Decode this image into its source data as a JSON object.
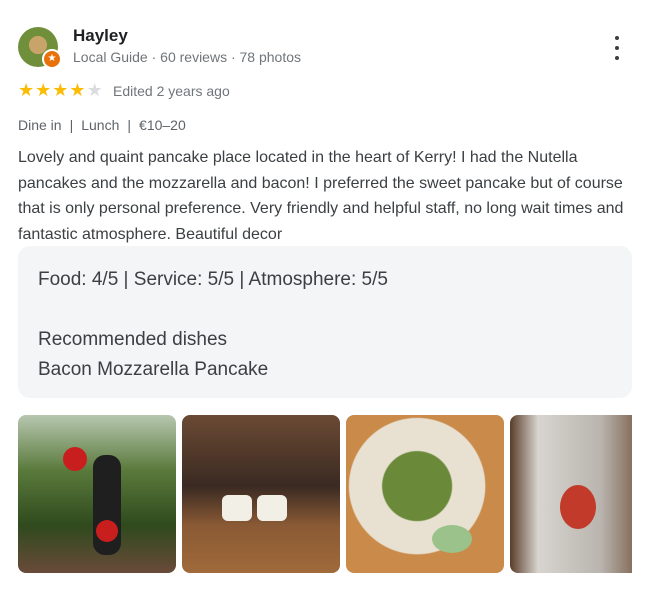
{
  "reviewer": {
    "name": "Hayley",
    "meta": "Local Guide · 60 reviews · 78 photos",
    "badge_icon": "local-guide-star"
  },
  "rating": {
    "stars": 4,
    "max": 5,
    "edited": "Edited 2 years ago"
  },
  "tags": {
    "dine": "Dine in",
    "sep1": "|",
    "meal": "Lunch",
    "sep2": "|",
    "price": "€10–20"
  },
  "review_text": "Lovely and quaint pancake place located in the heart of Kerry! I had the Nutella pancakes and the mozzarella and bacon! I preferred the sweet pancake but of course that is only personal preference. Very friendly and helpful staff, no long wait times and fantastic atmosphere. Beautiful decor",
  "ratings_card": {
    "scores": "Food: 4/5  |  Service: 5/5  |  Atmosphere: 5/5",
    "recommended_heading": "Recommended dishes",
    "recommended_dish": "Bacon Mozzarella Pancake"
  },
  "colors": {
    "star": "#fbbc04",
    "star_empty": "#dadce0",
    "badge": "#e8710a",
    "card_bg": "#f1f3f4"
  }
}
